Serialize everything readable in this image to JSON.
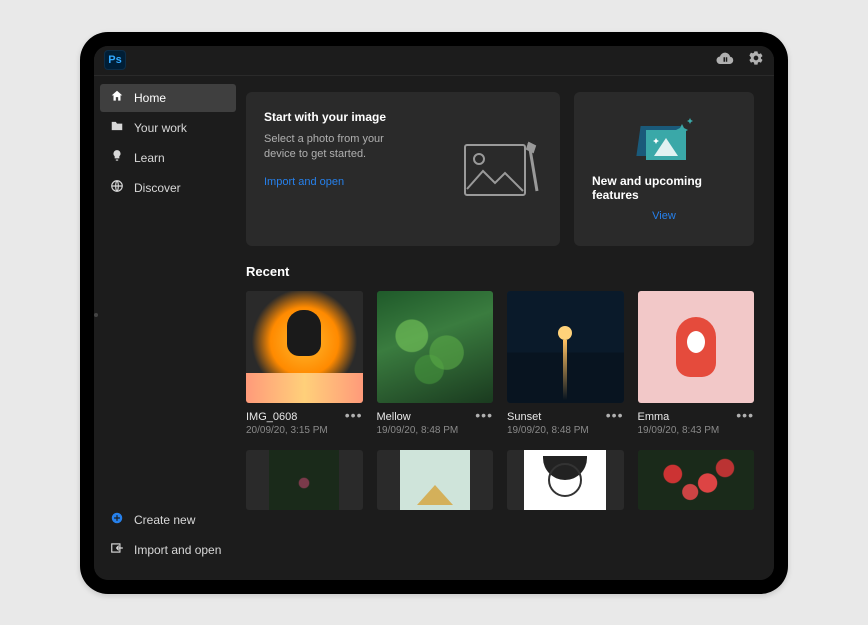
{
  "app": {
    "badge": "Ps"
  },
  "sidebar": {
    "items": [
      {
        "label": "Home"
      },
      {
        "label": "Your work"
      },
      {
        "label": "Learn"
      },
      {
        "label": "Discover"
      }
    ],
    "bottom": [
      {
        "label": "Create new"
      },
      {
        "label": "Import and open"
      }
    ]
  },
  "cards": {
    "start": {
      "title": "Start with your image",
      "subtitle": "Select a photo from your device to get started.",
      "action": "Import and open"
    },
    "features": {
      "title": "New and upcoming features",
      "action": "View"
    }
  },
  "recent": {
    "title": "Recent",
    "items": [
      {
        "name": "IMG_0608",
        "date": "20/09/20, 3:15 PM"
      },
      {
        "name": "Mellow",
        "date": "19/09/20, 8:48 PM"
      },
      {
        "name": "Sunset",
        "date": "19/09/20, 8:48 PM"
      },
      {
        "name": "Emma",
        "date": "19/09/20, 8:43 PM"
      }
    ]
  }
}
